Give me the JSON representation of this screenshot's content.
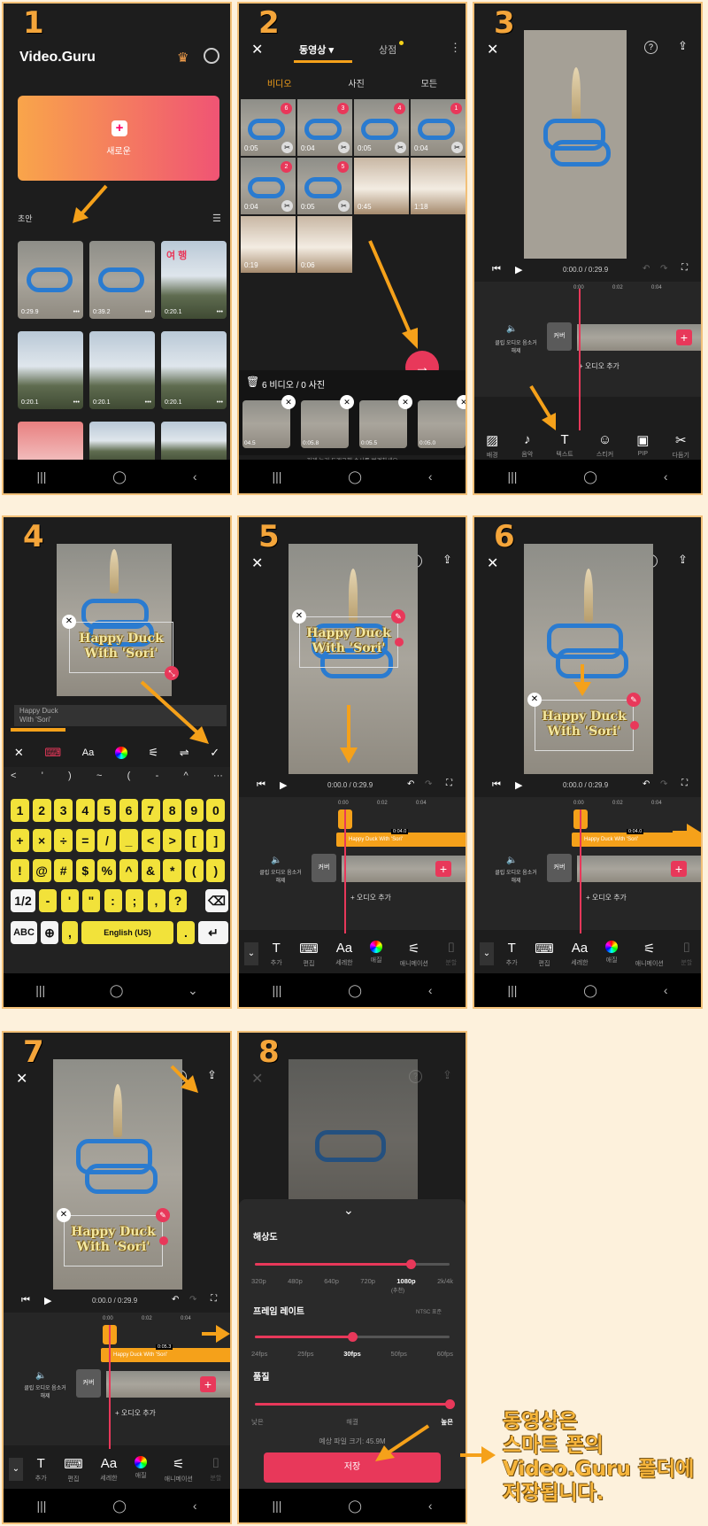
{
  "panel_numbers": [
    "1",
    "2",
    "3",
    "4",
    "5",
    "6",
    "7",
    "8"
  ],
  "p1": {
    "logo": "Video.Guru",
    "new_label": "새로운",
    "drafts_label": "초안",
    "drafts": [
      {
        "duration": "0:29.9",
        "more": "•••"
      },
      {
        "duration": "0:39.2",
        "more": "•••"
      },
      {
        "duration": "0:20.1",
        "more": "•••",
        "overlay": "여 행"
      },
      {
        "duration": "0:20.1",
        "more": "•••"
      },
      {
        "duration": "0:20.1",
        "more": "•••"
      },
      {
        "duration": "0:20.1",
        "more": "•••"
      }
    ]
  },
  "p2": {
    "tabs": {
      "video": "동영상",
      "store": "상점"
    },
    "sub_tabs": [
      "비디오",
      "사진",
      "모든"
    ],
    "clips": [
      {
        "d": "0:05",
        "n": "6"
      },
      {
        "d": "0:04",
        "n": "3"
      },
      {
        "d": "0:05",
        "n": "4"
      },
      {
        "d": "0:04",
        "n": "1"
      },
      {
        "d": "0:04",
        "n": "2"
      },
      {
        "d": "0:05",
        "n": "5"
      },
      {
        "d": "0:45"
      },
      {
        "d": "1:18"
      },
      {
        "d": "0:19"
      },
      {
        "d": "0:06"
      }
    ],
    "selection": "6 비디오 / 0 사진",
    "tray": [
      "04.5",
      "0:05.8",
      "0:05.5",
      "0:05.0"
    ],
    "hint": "길게 눌러 드래그해 순서를 변경하세요"
  },
  "p3": {
    "time": "0:00.0 / 0:29.9",
    "ruler": [
      "0:00",
      "0:02",
      "0:04"
    ],
    "audio_label": "클립 오디오 음소거 해제",
    "cover": "커버",
    "add_audio": "+ 오디오 추가",
    "tools": [
      "배경",
      "음악",
      "텍스트",
      "스티커",
      "PIP",
      "다듬기"
    ]
  },
  "p4": {
    "overlay": "Happy Duck\nWith 'Sori'",
    "input": "Happy Duck\nWith 'Sori'",
    "aa": "Aa",
    "sym_row": [
      "<",
      "'",
      ")",
      "~",
      "(",
      "-",
      "^",
      "···"
    ],
    "row1": [
      "1",
      "2",
      "3",
      "4",
      "5",
      "6",
      "7",
      "8",
      "9",
      "0"
    ],
    "row2": [
      "+",
      "×",
      "÷",
      "=",
      "/",
      "_",
      "<",
      ">",
      "[",
      "]"
    ],
    "row3": [
      "!",
      "@",
      "#",
      "$",
      "%",
      "^",
      "&",
      "*",
      "(",
      ")"
    ],
    "row4": [
      "1/2",
      "-",
      "'",
      "\"",
      ":",
      ";",
      ",",
      "?"
    ],
    "abc": "ABC",
    "lang": "English (US)",
    "period": ".",
    "comma": ","
  },
  "p5": {
    "overlay": "Happy Duck\nWith 'Sori'",
    "time": "0:00.0 / 0:29.9",
    "ruler": [
      "0:00",
      "0:02",
      "0:04"
    ],
    "text_clip": "Happy Duck With 'Sori'",
    "clip_dur": "0:04.0",
    "audio_label": "클립 오디오 음소거 해제",
    "cover": "커버",
    "add_audio": "+ 오디오 추가",
    "tools": [
      "추가",
      "편집",
      "세레한",
      "애질",
      "애니메이션",
      "분할"
    ],
    "aa": "Aa"
  },
  "p6": {
    "overlay": "Happy Duck\nWith 'Sori'",
    "time": "0:00.0 / 0:29.9",
    "ruler": [
      "0:00",
      "0:02",
      "0:04"
    ],
    "text_clip": "Happy Duck With 'Sori'",
    "clip_dur": "0:04.0",
    "audio_label": "클립 오디오 음소거 해제",
    "cover": "커버",
    "add_audio": "+ 오디오 추가",
    "tools": [
      "추가",
      "편집",
      "세레한",
      "애질",
      "애니메이션",
      "분할"
    ],
    "aa": "Aa"
  },
  "p7": {
    "overlay": "Happy Duck\nWith 'Sori'",
    "time": "0:00.0 / 0:29.9",
    "ruler": [
      "0:00",
      "0:02",
      "0:04"
    ],
    "text_clip": "Happy Duck With 'Sori'",
    "clip_dur": "0:05.3",
    "audio_label": "클립 오디오 음소거 해제",
    "cover": "커버",
    "add_audio": "+ 오디오 추가",
    "tools": [
      "추가",
      "편집",
      "세레한",
      "애질",
      "애니메이션",
      "분할"
    ],
    "aa": "Aa"
  },
  "p8": {
    "resolution": "해상도",
    "res_opts": [
      "320p",
      "480p",
      "640p",
      "720p",
      "1080p",
      "2k/4k"
    ],
    "res_sel": 4,
    "res_note": "(추천)",
    "res_level": 0.8,
    "framerate": "프레임 레이트",
    "ntsc": "NTSC 표준",
    "fps_opts": [
      "24fps",
      "25fps",
      "30fps",
      "50fps",
      "60fps"
    ],
    "fps_sel": 2,
    "fps_level": 0.5,
    "quality": "품질",
    "q_opts": [
      "낮은",
      "해결",
      "높은"
    ],
    "q_sel": 2,
    "q_level": 1.0,
    "size": "예상 파일 크기: 45.9M",
    "save": "저장"
  },
  "note": "동영상은\n스마트 폰의\nVideo.Guru 폴더에\n저장됩니다."
}
